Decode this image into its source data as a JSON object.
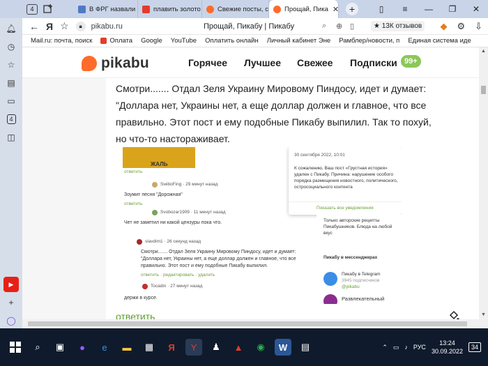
{
  "browser": {
    "tab_count": "4",
    "tabs": [
      {
        "label": "В ФРГ назвали «",
        "color": "#4f79c7"
      },
      {
        "label": "плавить золото",
        "color": "#e53b2c"
      },
      {
        "label": "Свежие посты, с",
        "color": "#ff6b2a"
      },
      {
        "label": "Прощай, Пика",
        "color": "#ff6b2a"
      }
    ],
    "window_controls": [
      "≡",
      "—",
      "❐",
      "✕"
    ],
    "url": "pikabu.ru",
    "page_title": "Прощай, Пикабу | Пикабу",
    "reviews": "★ 13К отзывов",
    "bookmarks": [
      {
        "label": "Mail.ru: почта, поиск",
        "color": "#1565c0"
      },
      {
        "label": "Oплата",
        "color": "#e53b2c"
      },
      {
        "label": "Google",
        "color": ""
      },
      {
        "label": "YouTube",
        "color": ""
      },
      {
        "label": "Оплатить онлайн",
        "color": ""
      },
      {
        "label": "Личный кабинет Эне",
        "color": ""
      },
      {
        "label": "Рамблер/новости, п",
        "color": ""
      },
      {
        "label": "Единая система иде",
        "color": ""
      }
    ],
    "sidebar_count": "4"
  },
  "site": {
    "logo": "pikabu",
    "nav": [
      "Горячее",
      "Лучшее",
      "Свежее",
      "Подписки"
    ],
    "badge": "99+",
    "post_text": "Смотри....... Отдал Зеля Украину Мировому Пиндосу, идет и думает: \"Доллара нет, Украины нет, а еще доллар должен и главное, что все правильно. Этот пост и ему подобные Пикабу выпилил. Так то похуй, но что-то настораживает.",
    "reply": "ответить"
  },
  "screenshot": {
    "image_caption": "ЖАЛЬ",
    "reply1": "ответить",
    "user1": "SwiboFing · 29 минут назад",
    "text1": "Зоумит песня \"Дорожная\"",
    "reply2": "ответить",
    "user2": "Svobozar1909 · 11 минут назад",
    "text2": "Чет не заметил ни какой цензуры пока что.",
    "user3": "slavdim1 · 26 секунд назад",
    "text3": "Смотри....... Отдал Зеля Украину Мировому Пиндосу, идет и думает: \"Доллара нет, Украины нет, а еще доллар должен и главное, что все правильно. Этот пост и ему подобные Пикабу выпилил.",
    "actions3": "ответить · редактировать · удалить",
    "user4": "Tocadin · 27 минут назад",
    "text4": "держи в курсе.",
    "notif_date": "30 сентября 2022, 10:01",
    "notif_text": "К сожалению, Ваш пост «Грустная история» удален с Пикабу. Причина: нарушение особого порядка размещения новостного, политического, остросоциального контента",
    "notif_link": "Показать все уведомления",
    "right_text": "Только авторские рецепты Пикабушников. Блюда на любой вкус",
    "messengers": "Пикабу в мессенджерах",
    "telegram": "Пикабу в Telegram",
    "telegram_sub": "3945 подписчиков",
    "telegram_handle": "@pikabu",
    "ent": "Развлекательный"
  },
  "taskbar": {
    "lang": "РУС",
    "time": "13:24",
    "date": "30.09.2022",
    "notif_count": "34"
  }
}
